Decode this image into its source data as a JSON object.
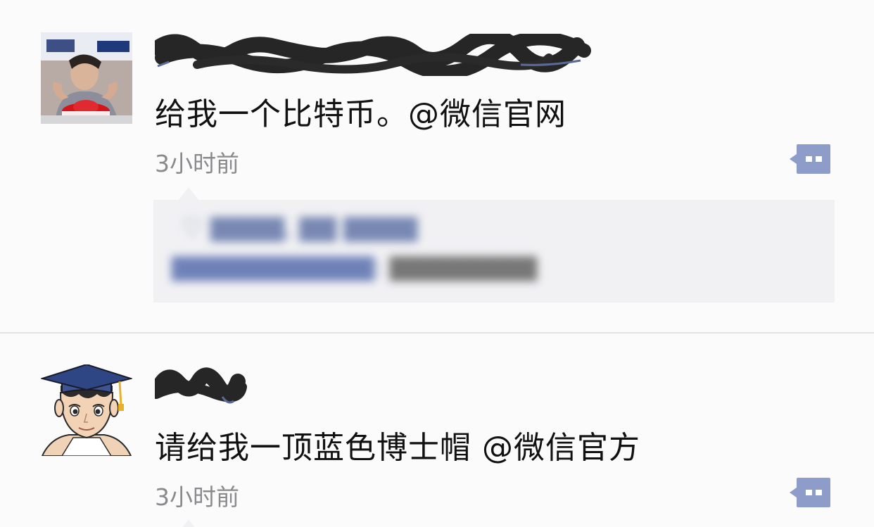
{
  "colors": {
    "background": "#fbfbfc",
    "username": "#5b6b96",
    "content_text": "#111111",
    "timestamp": "#8a8a8d",
    "comment_icon": "#8d9cc8",
    "comments_box": "#f1f1f4",
    "divider": "#e4e4e6"
  },
  "posts": [
    {
      "avatar": "photo-avatar",
      "username": "",
      "content": "给我一个比特币。@微信官网",
      "time": "3小时前",
      "comment_icon": "comment-icon",
      "comments": {
        "likes": "",
        "items": []
      }
    },
    {
      "avatar": "graduate-cartoon-avatar",
      "username": "",
      "content": "请给我一顶蓝色博士帽 @微信官方",
      "time": "3小时前",
      "comment_icon": "comment-icon"
    }
  ]
}
